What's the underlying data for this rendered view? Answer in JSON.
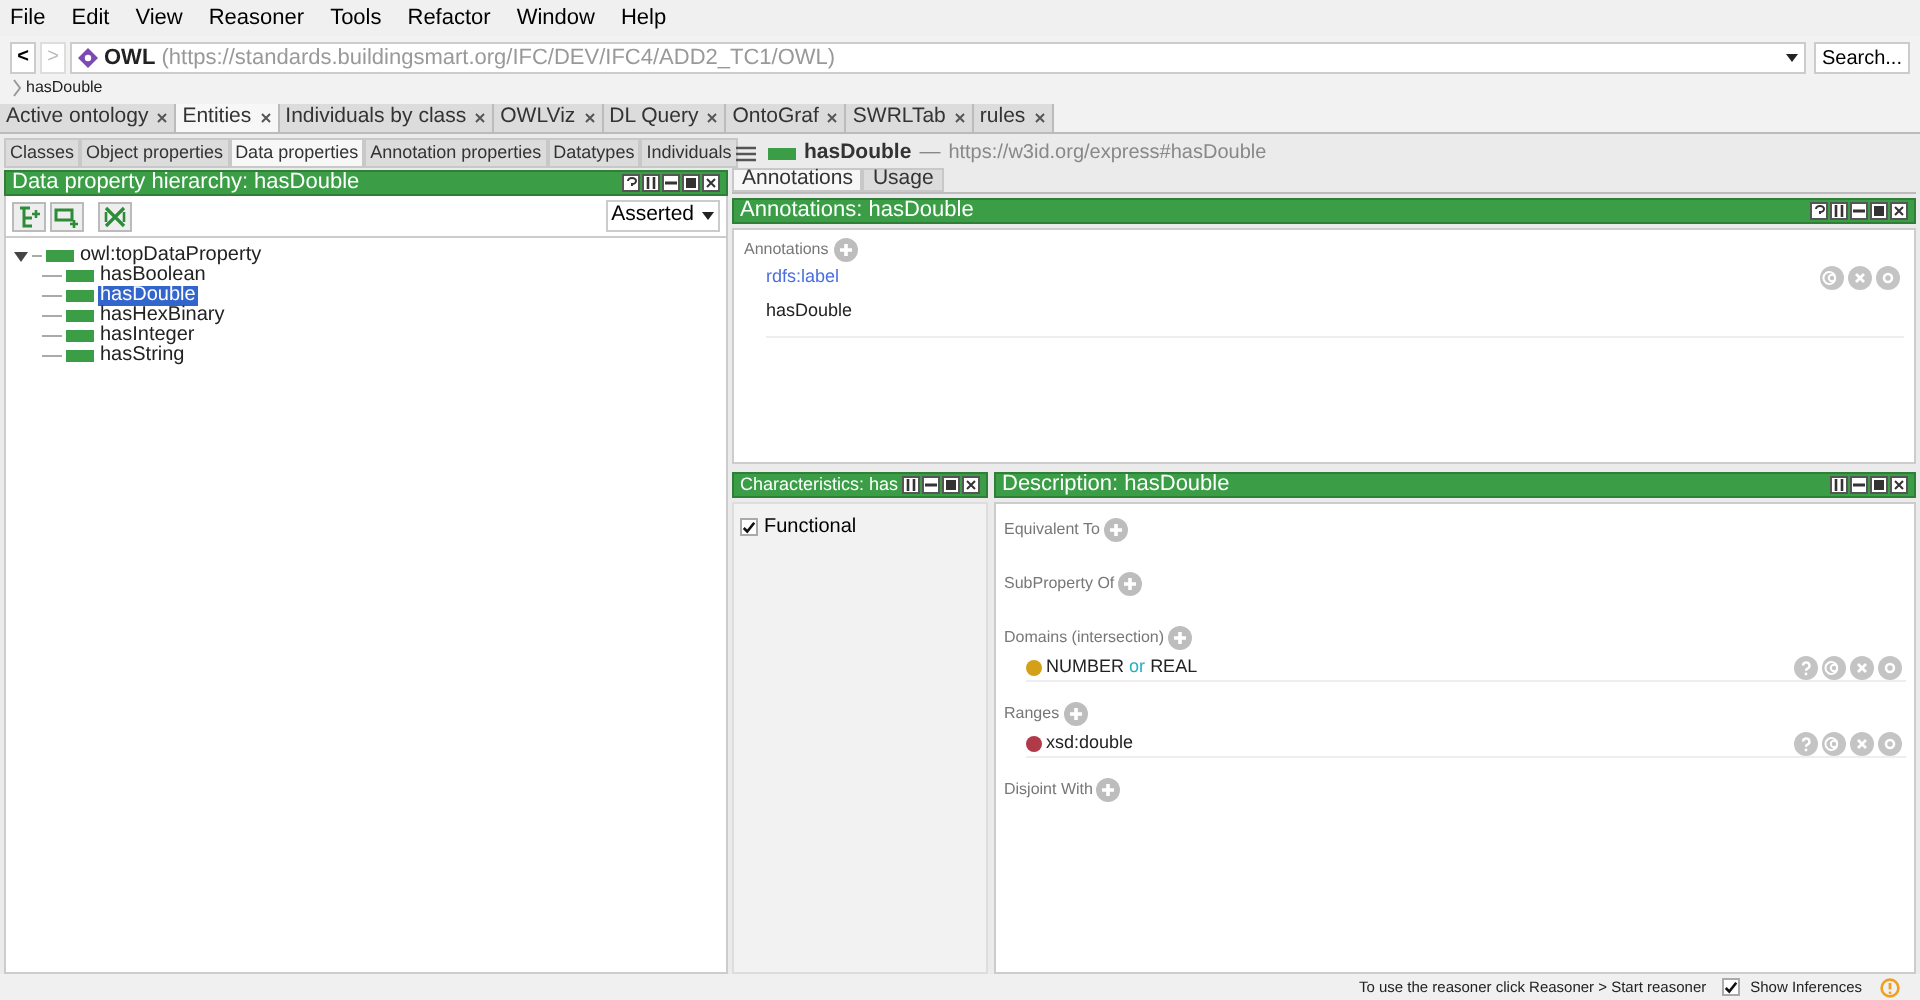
{
  "menu": [
    "File",
    "Edit",
    "View",
    "Reasoner",
    "Tools",
    "Refactor",
    "Window",
    "Help"
  ],
  "address": {
    "back": "<",
    "forward": ">",
    "ontology": "OWL",
    "iri": "(https://standards.buildingsmart.org/IFC/DEV/IFC4/ADD2_TC1/OWL)",
    "search_button": "Search..."
  },
  "breadcrumb": "hasDouble",
  "workspace_tabs": [
    {
      "label": "Active ontology",
      "selected": false
    },
    {
      "label": "Entities",
      "selected": true
    },
    {
      "label": "Individuals by class",
      "selected": false
    },
    {
      "label": "OWLViz",
      "selected": false
    },
    {
      "label": "DL Query",
      "selected": false
    },
    {
      "label": "OntoGraf",
      "selected": false
    },
    {
      "label": "SWRLTab",
      "selected": false
    },
    {
      "label": "rules",
      "selected": false
    }
  ],
  "entity_tabs": [
    {
      "label": "Classes",
      "selected": false
    },
    {
      "label": "Object properties",
      "selected": false
    },
    {
      "label": "Data properties",
      "selected": true
    },
    {
      "label": "Annotation properties",
      "selected": false
    },
    {
      "label": "Datatypes",
      "selected": false
    },
    {
      "label": "Individuals",
      "selected": false
    }
  ],
  "hierarchy": {
    "title": "Data property hierarchy: hasDouble",
    "mode": "Asserted",
    "tree": [
      {
        "label": "owl:topDataProperty",
        "selected": false,
        "expanded": true,
        "children": [
          {
            "label": "hasBoolean",
            "selected": false
          },
          {
            "label": "hasDouble",
            "selected": true
          },
          {
            "label": "hasHexBinary",
            "selected": false
          },
          {
            "label": "hasInteger",
            "selected": false
          },
          {
            "label": "hasString",
            "selected": false
          }
        ]
      }
    ]
  },
  "entity": {
    "name": "hasDouble",
    "separator": "—",
    "iri": "https://w3id.org/express#hasDouble"
  },
  "view_tabs": [
    {
      "label": "Annotations",
      "selected": true
    },
    {
      "label": "Usage",
      "selected": false
    }
  ],
  "annotations": {
    "title": "Annotations: hasDouble",
    "section": "Annotations",
    "items": [
      {
        "property": "rdfs:label",
        "value": "hasDouble"
      }
    ]
  },
  "characteristics": {
    "title": "Characteristics: has",
    "items": [
      {
        "label": "Functional",
        "checked": true
      }
    ]
  },
  "description": {
    "title": "Description: hasDouble",
    "sections": [
      {
        "label": "Equivalent To"
      },
      {
        "label": "SubProperty Of"
      },
      {
        "label": "Domains (intersection)",
        "items": [
          {
            "color": "#d4a017",
            "parts": [
              {
                "text": "NUMBER",
                "kind": "name"
              },
              {
                "text": "or",
                "kind": "keyword"
              },
              {
                "text": "REAL",
                "kind": "name"
              }
            ]
          }
        ]
      },
      {
        "label": "Ranges",
        "items": [
          {
            "color": "#b03a48",
            "parts": [
              {
                "text": "xsd:double",
                "kind": "name"
              }
            ]
          }
        ]
      },
      {
        "label": "Disjoint With"
      }
    ]
  },
  "status": {
    "message": "To use the reasoner click Reasoner > Start reasoner",
    "show_inferences": {
      "label": "Show Inferences",
      "checked": true
    }
  }
}
